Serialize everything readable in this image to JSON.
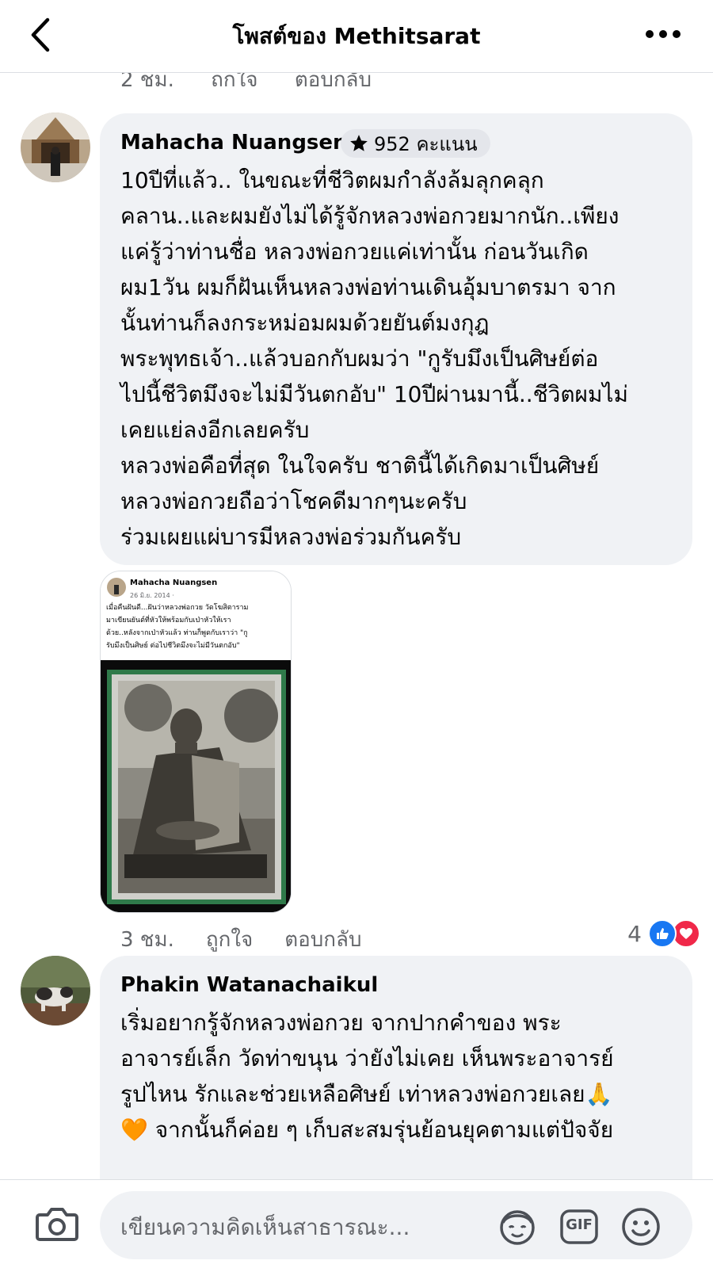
{
  "header": {
    "title": "โพสต์ของ Methitsarat"
  },
  "previous_comment": {
    "time": "2 ชม.",
    "like_label": "ถูกใจ",
    "reply_label": "ตอบกลับ"
  },
  "comments": [
    {
      "author": "Mahacha Nuangsen",
      "badge": "952 คะแนน",
      "lines": [
        "10ปีที่แล้ว.. ในขณะที่ชีวิตผมกำลังล้มลุกคลุก",
        "คลาน..และผมยังไม่ได้รู้จักหลวงพ่อกวยมากนัก..เพียง",
        "แค่รู้ว่าท่านชื่อ หลวงพ่อกวยแค่เท่านั้น   ก่อนวันเกิด",
        "ผม1วัน ผมก็ฝันเห็นหลวงพ่อท่านเดินอุ้มบาตรมา จาก",
        "นั้นท่านก็ลงกระหม่อมผมด้วยยันต์มงกุฎ",
        "พระพุทธเจ้า..แล้วบอกกับผมว่า \"กูรับมึงเป็นศิษย์ต่อ",
        "ไปนี้ชีวิตมึงจะไม่มีวันตกอับ\" 10ปีผ่านมานี้..ชีวิตผมไม่",
        "เคยแย่ลงอีกเลยครับ",
        "หลวงพ่อคือที่สุด ในใจครับ ชาตินี้ได้เกิดมาเป็นศิษย์",
        "หลวงพ่อกวยถือว่าโชคดีมากๆนะครับ",
        "ร่วมเผยแผ่บารมีหลวงพ่อร่วมกันครับ"
      ],
      "attachment": {
        "name": "Mahacha Nuangsen",
        "date": "26 มิ.ย. 2014 ·",
        "text_lines": [
          "เมื่อคืนฝันดี...ฝันว่าหลวงพ่อกวย วัดโฆสิตาราม",
          "มาเขียนยันต์ที่หัวให้พร้อมกับเป่าหัวให้เรา",
          "ด้วย..หลังจากเป่าหัวแล้ว ท่านก็พูดกับเราว่า \"กู",
          "รับมึงเป็นศิษย์ ต่อไปชีวิตมึงจะไม่มีวันตกอับ\""
        ]
      },
      "time": "3 ชม.",
      "like_label": "ถูกใจ",
      "reply_label": "ตอบกลับ",
      "reaction_count": "4",
      "reactions": [
        "like-icon",
        "love-icon"
      ]
    },
    {
      "author": "Phakin Watanachaikul",
      "lines": [
        "เริ่มอยากรู้จักหลวงพ่อกวย จากปากคำของ พระ",
        "อาจารย์เล็ก วัดท่าขนุน ว่ายังไม่เคย เห็นพระอาจารย์",
        "รูปไหน รักและช่วยเหลือศิษย์ เท่าหลวงพ่อกวยเลย🙏",
        "🧡 จากนั้นก็ค่อย ๆ เก็บสะสมรุ่นย้อนยุคตามแต่ปัจจัย"
      ]
    }
  ],
  "composer": {
    "placeholder": "เขียนความคิดเห็นสาธารณะ...",
    "gif_label": "GIF"
  },
  "colors": {
    "bubble": "#f0f2f5",
    "secondary_text": "#65676b",
    "like_blue": "#1877f2",
    "love_red": "#f02849"
  }
}
